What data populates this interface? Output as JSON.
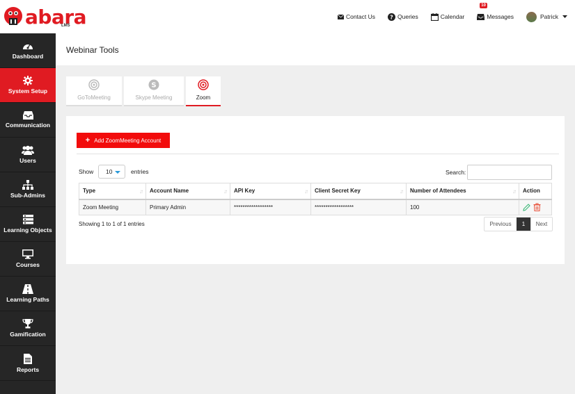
{
  "brand": {
    "name": "abara",
    "sub": "LMS",
    "accent": "#e01b22"
  },
  "topnav": {
    "contact": "Contact Us",
    "queries": "Queries",
    "calendar": "Calendar",
    "messages": "Messages",
    "messages_badge": "10",
    "user": "Patrick"
  },
  "sidebar": {
    "items": [
      {
        "label": "Dashboard",
        "icon": "dashboard-icon"
      },
      {
        "label": "System Setup",
        "icon": "gear-icon",
        "active": true
      },
      {
        "label": "Communication",
        "icon": "inbox-icon"
      },
      {
        "label": "Users",
        "icon": "users-icon"
      },
      {
        "label": "Sub-Admins",
        "icon": "sitemap-icon"
      },
      {
        "label": "Learning Objects",
        "icon": "stack-icon"
      },
      {
        "label": "Courses",
        "icon": "monitor-icon"
      },
      {
        "label": "Learning Paths",
        "icon": "road-icon"
      },
      {
        "label": "Gamification",
        "icon": "trophy-icon"
      },
      {
        "label": "Reports",
        "icon": "report-icon"
      }
    ]
  },
  "page": {
    "title": "Webinar Tools"
  },
  "tabs": [
    {
      "label": "GoToMeeting",
      "icon": "target-icon"
    },
    {
      "label": "Skype Meeting",
      "icon": "skype-icon"
    },
    {
      "label": "Zoom",
      "icon": "zoom-target-icon",
      "active": true
    }
  ],
  "panel": {
    "add_button": "Add ZoomMeeting Account",
    "show_label": "Show",
    "page_length": "10",
    "entries_label": "entries",
    "search_label": "Search:",
    "columns": [
      "Type",
      "Account Name",
      "API Key",
      "Client Secret Key",
      "Number of Attendees",
      "Action"
    ],
    "rows": [
      {
        "type": "Zoom Meeting",
        "account": "Primary Admin",
        "api_key": "******************",
        "secret": "******************",
        "attendees": "100"
      }
    ],
    "info": "Showing 1 to 1 of 1 entries",
    "pager": {
      "prev": "Previous",
      "current": "1",
      "next": "Next"
    }
  }
}
